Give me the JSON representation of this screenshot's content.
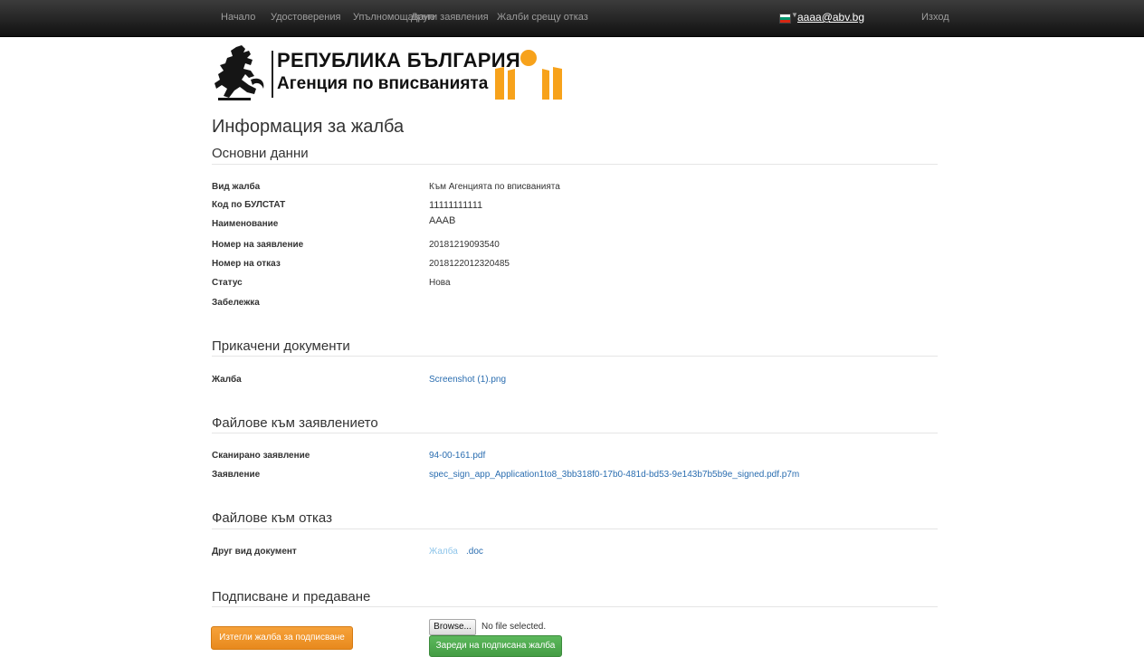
{
  "nav": {
    "home": "Начало",
    "certificates": "Удостоверения",
    "authorizations": "Упълномощаване",
    "other_applications": "Други заявления",
    "complaints": "Жалби срещу отказ",
    "user_email": "aaaa@abv.bg",
    "logout": "Изход"
  },
  "logo": {
    "line1": "РЕПУБЛИКА БЪЛГАРИЯ",
    "line2": "Агенция по вписванията"
  },
  "page_title": "Информация за жалба",
  "basic": {
    "heading": "Основни данни",
    "rows": [
      {
        "label": "Вид жалба",
        "value": "Към Агенцията по вписванията"
      },
      {
        "label": "Код по БУЛСТАТ",
        "value": "11111111111"
      },
      {
        "label": "Наименование",
        "value": "AAAB"
      },
      {
        "label": "Номер на заявление",
        "value": "20181219093540"
      },
      {
        "label": "Номер на отказ",
        "value": "2018122012320485"
      },
      {
        "label": "Статус",
        "value": "Нова"
      },
      {
        "label": "Забележка",
        "value": ""
      }
    ]
  },
  "attached": {
    "heading": "Прикачени документи",
    "rows": [
      {
        "label": "Жалба",
        "value": "Screenshot (1).png"
      }
    ]
  },
  "application_files": {
    "heading": "Файлове към заявлението",
    "rows": [
      {
        "label": "Сканирано заявление",
        "value": "94-00-161.pdf"
      },
      {
        "label": "Заявление",
        "value": "spec_sign_app_Application1to8_3bb318f0-17b0-481d-bd53-9e143b7b5b9e_signed.pdf.p7m"
      }
    ]
  },
  "refusal_files": {
    "heading": "Файлове към отказ",
    "rows": [
      {
        "label": "Друг вид документ",
        "value_part1": "Жалба",
        "value_part2": ".doc"
      }
    ]
  },
  "signing": {
    "heading": "Подписване и предаване",
    "download_button": "Изтегли жалба за подписване",
    "browse_button": "Browse...",
    "no_file": "No file selected.",
    "upload_button": "Зареди на подписана жалба"
  },
  "colors": {
    "link": "#2a6db0",
    "orange_button": "#f0982c",
    "green_button": "#5cb85c",
    "navbar": "#222222"
  }
}
